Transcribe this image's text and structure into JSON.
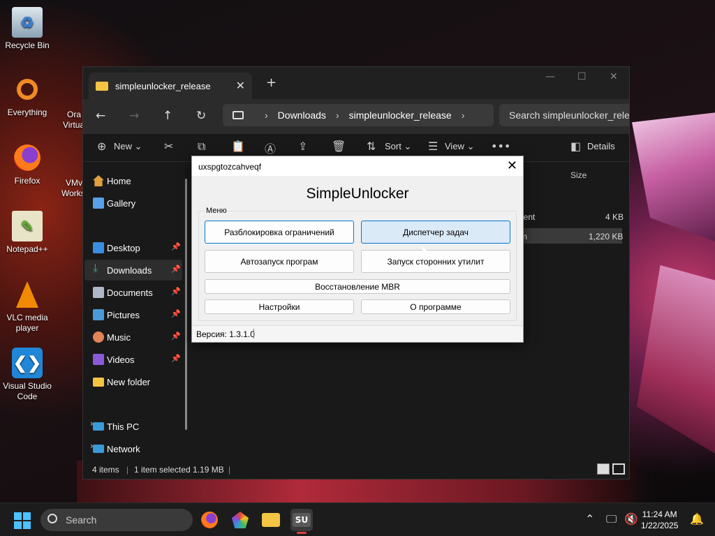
{
  "desktop": {
    "icons": [
      {
        "label": "Recycle Bin",
        "icon": "recycle-bin-icon"
      },
      {
        "label": "Everything",
        "icon": "everything-search-icon"
      },
      {
        "label": "Firefox",
        "icon": "firefox-icon"
      },
      {
        "label": "Notepad++",
        "icon": "notepad-plus-plus-icon"
      },
      {
        "label": "VLC media player",
        "icon": "vlc-cone-icon"
      },
      {
        "label": "Visual Studio Code",
        "icon": "vscode-icon"
      }
    ],
    "partial_labels": [
      "Ora",
      "Virtua",
      "VMv",
      "Works"
    ]
  },
  "explorer": {
    "tab_title": "simpleunlocker_release",
    "breadcrumb": [
      "Downloads",
      "simpleunlocker_release"
    ],
    "search_placeholder": "Search simpleunlocker_relea",
    "toolbar": {
      "new": "New",
      "sort": "Sort",
      "view": "View",
      "details": "Details"
    },
    "sidebar": [
      {
        "label": "Home",
        "icon": "home-icon"
      },
      {
        "label": "Gallery",
        "icon": "gallery-icon"
      },
      {
        "label": "Desktop",
        "icon": "desktop-folder-icon",
        "pinned": true
      },
      {
        "label": "Downloads",
        "icon": "download-icon",
        "pinned": true,
        "selected": true
      },
      {
        "label": "Documents",
        "icon": "documents-icon",
        "pinned": true
      },
      {
        "label": "Pictures",
        "icon": "pictures-icon",
        "pinned": true
      },
      {
        "label": "Music",
        "icon": "music-icon",
        "pinned": true
      },
      {
        "label": "Videos",
        "icon": "videos-icon",
        "pinned": true
      },
      {
        "label": "New folder",
        "icon": "folder-icon"
      },
      {
        "label": "This PC",
        "icon": "this-pc-icon"
      },
      {
        "label": "Network",
        "icon": "network-icon"
      }
    ],
    "columns": {
      "size": "Size"
    },
    "rows": [
      {
        "name_fragment": "ument",
        "size": "4 KB"
      },
      {
        "name_fragment": "ion",
        "size": "1,220 KB"
      }
    ],
    "status": {
      "items": "4 items",
      "selected": "1 item selected  1.19 MB"
    }
  },
  "dialog": {
    "title": "uxspgtozcahveqf",
    "heading": "SimpleUnlocker",
    "group_label": "Меню",
    "buttons": {
      "unlock": "Разблокировка ограничений",
      "task_manager": "Диспетчер задач",
      "autorun": "Автозапуск програм",
      "utilities": "Запуск сторонних утилит",
      "mbr": "Восстановление MBR",
      "settings": "Настройки",
      "about": "О программе"
    },
    "version": "Версия: 1.3.1.0"
  },
  "taskbar": {
    "search_label": "Search",
    "time": "11:24 AM",
    "date": "1/22/2025",
    "app_label": "SU"
  }
}
